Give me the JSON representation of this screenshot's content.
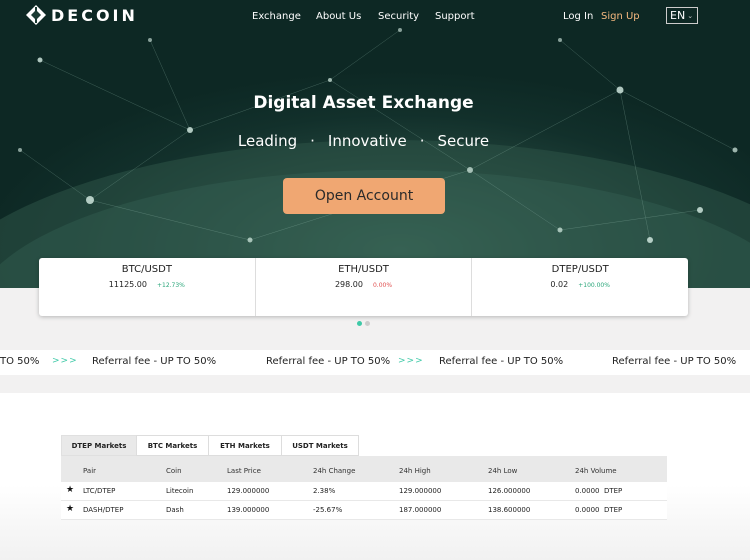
{
  "brand": {
    "name": "DECOIN"
  },
  "nav": {
    "links": [
      "Exchange",
      "About Us",
      "Security",
      "Support"
    ],
    "login": "Log In",
    "signup": "Sign Up",
    "lang": "EN"
  },
  "hero": {
    "title": "Digital Asset Exchange",
    "taglines": [
      "Leading",
      "Innovative",
      "Secure"
    ],
    "separator": "·",
    "cta": "Open Account"
  },
  "tickers": [
    {
      "pair": "BTC/USDT",
      "price": "11125.00",
      "change": "+12.73%",
      "trend": "up"
    },
    {
      "pair": "ETH/USDT",
      "price": "298.00",
      "change": "0.00%",
      "trend": "flat"
    },
    {
      "pair": "DTEP/USDT",
      "price": "0.02",
      "change": "+100.00%",
      "trend": "up"
    }
  ],
  "carousel": {
    "pages": 2,
    "active": 0
  },
  "marquee": {
    "items": [
      "TO 50%",
      "Referral fee - UP TO 50%",
      "Referral fee - UP TO 50%",
      "Referral fee - UP TO 50%",
      "Referral fee - UP TO 50%"
    ],
    "separator": ">>>"
  },
  "markets": {
    "tabs": [
      "DTEP Markets",
      "BTC Markets",
      "ETH Markets",
      "USDT Markets"
    ],
    "active_tab": 0,
    "columns": [
      "Pair",
      "Coin",
      "Last Price",
      "24h Change",
      "24h High",
      "24h Low",
      "24h Volume"
    ],
    "rows": [
      {
        "pair": "LTC/DTEP",
        "coin": "Litecoin",
        "last": "129.000000",
        "change": "2.38%",
        "trend": "up",
        "high": "129.000000",
        "low": "126.000000",
        "volume": "0.0000  DTEP"
      },
      {
        "pair": "DASH/DTEP",
        "coin": "Dash",
        "last": "139.000000",
        "change": "-25.67%",
        "trend": "down",
        "high": "187.000000",
        "low": "138.600000",
        "volume": "0.0000  DTEP"
      }
    ]
  },
  "colors": {
    "accent": "#f0a772",
    "up": "#2aa67a",
    "down": "#e05050",
    "teal": "#3ec9a7"
  }
}
